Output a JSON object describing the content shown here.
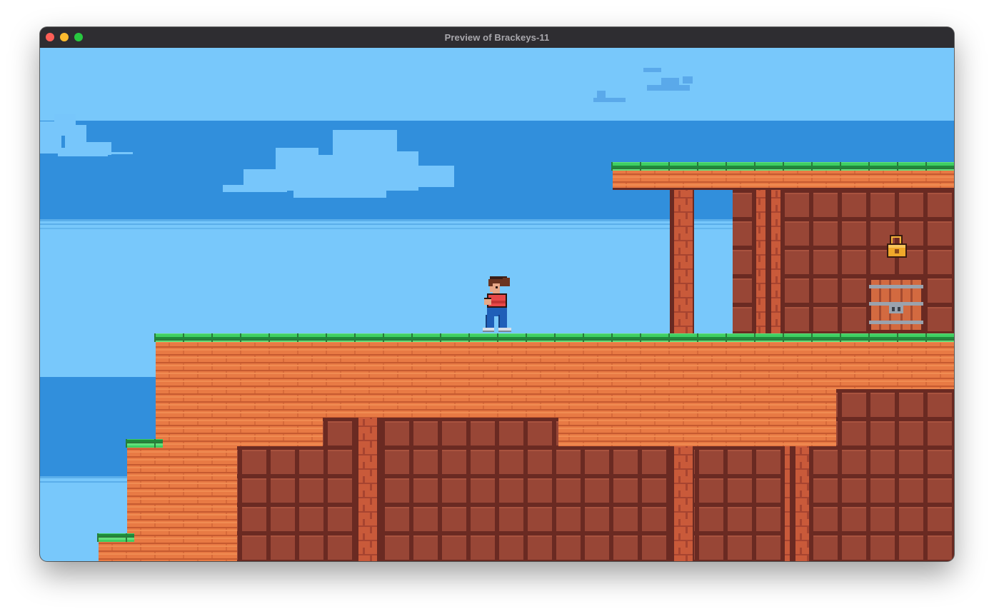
{
  "window": {
    "title": "Preview of Brackeys-11",
    "controls": [
      "close",
      "minimize",
      "maximize"
    ]
  },
  "game": {
    "player": "player-character",
    "pickups": [
      "lock-icon"
    ],
    "doors": [
      "locked-door"
    ],
    "palette": {
      "sky_light": "#78c8fb",
      "sky_band": "#318fdc",
      "cloud": "#77c6fb",
      "grass": "#3fcf62",
      "brick": "#e57640",
      "wall_dark": "#984636",
      "mortar": "#6a2a22"
    }
  }
}
